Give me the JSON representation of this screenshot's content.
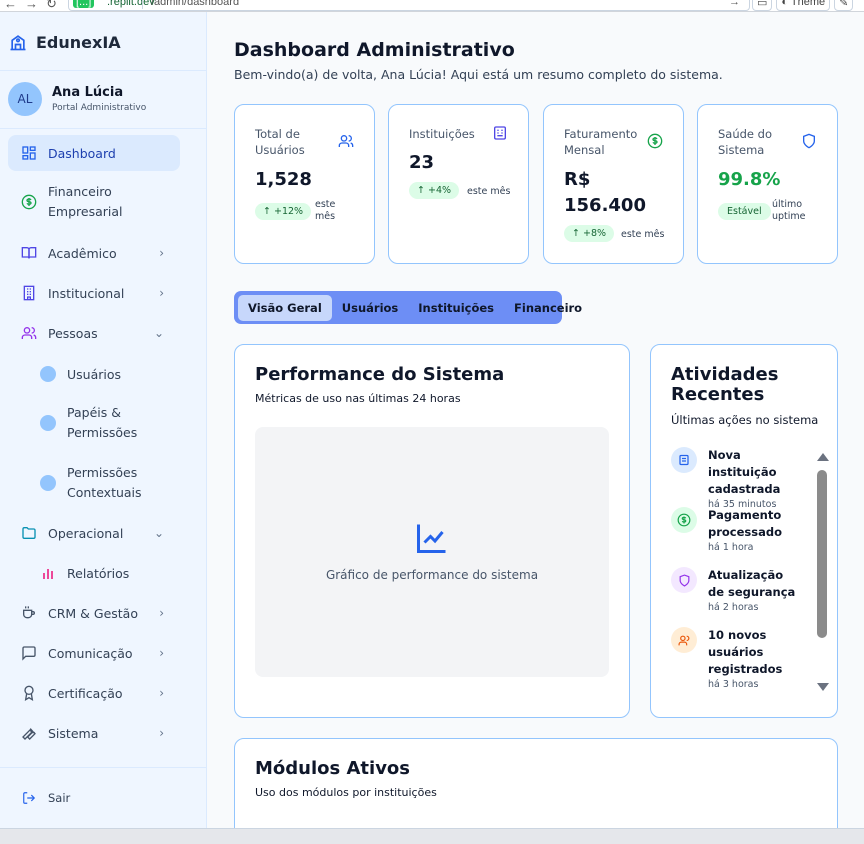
{
  "browser": {
    "host_badge": "[...]",
    "host_rest": ".replit.dev",
    "path": "/admin/dashboard",
    "theme_label": "Theme"
  },
  "app": {
    "name": "EdunexIA"
  },
  "user": {
    "initials": "AL",
    "name": "Ana Lúcia",
    "role": "Portal Administrativo"
  },
  "sidebar": {
    "items": [
      {
        "label": "Dashboard",
        "icon": "grid-icon",
        "active": true
      },
      {
        "label": "Financeiro Empresarial",
        "icon": "dollar-circle-icon"
      },
      {
        "label": "Acadêmico",
        "icon": "book-open-icon",
        "chevron": "right"
      },
      {
        "label": "Institucional",
        "icon": "building-icon",
        "chevron": "right"
      },
      {
        "label": "Pessoas",
        "icon": "users-icon",
        "chevron": "down"
      },
      {
        "label": "Operacional",
        "icon": "folder-icon",
        "chevron": "down"
      },
      {
        "label": "CRM & Gestão",
        "icon": "coffee-icon",
        "chevron": "right"
      },
      {
        "label": "Comunicação",
        "icon": "message-square-icon",
        "chevron": "right"
      },
      {
        "label": "Certificação",
        "icon": "award-icon",
        "chevron": "right"
      },
      {
        "label": "Sistema",
        "icon": "wrench-icon",
        "chevron": "right"
      }
    ],
    "pessoas_sub": [
      {
        "label": "Usuários"
      },
      {
        "label": "Papéis & Permissões"
      },
      {
        "label": "Permissões Contextuais"
      }
    ],
    "operacional_sub": [
      {
        "label": "Relatórios",
        "icon": "bar-chart-icon"
      }
    ],
    "logout_label": "Sair"
  },
  "header": {
    "title": "Dashboard Administrativo",
    "subtitle": "Bem-vindo(a) de volta, Ana Lúcia! Aqui está um resumo completo do sistema."
  },
  "stats": [
    {
      "label": "Total de Usuários",
      "value": "1,528",
      "change": "+12%",
      "note": "este mês",
      "icon": "users-icon",
      "color": "#2563eb"
    },
    {
      "label": "Instituições",
      "value": "23",
      "change": "+4%",
      "note": "este mês",
      "icon": "building-icon",
      "color": "#4f46e5"
    },
    {
      "label": "Faturamento Mensal",
      "value": "R$ 156.400",
      "change": "+8%",
      "note": "este mês",
      "icon": "dollar-circle-icon",
      "color": "#16a34a"
    },
    {
      "label": "Saúde do Sistema",
      "value": "99.8%",
      "change": "Estável",
      "note": "último uptime",
      "icon": "shield-icon",
      "color": "#2563eb",
      "value_color": "#16a34a"
    }
  ],
  "tabs": [
    {
      "label": "Visão Geral",
      "active": true
    },
    {
      "label": "Usuários"
    },
    {
      "label": "Instituições"
    },
    {
      "label": "Financeiro"
    }
  ],
  "performance": {
    "title": "Performance do Sistema",
    "subtitle": "Métricas de uso nas últimas 24 horas",
    "placeholder": "Gráfico de performance do sistema"
  },
  "activities": {
    "title": "Atividades Recentes",
    "subtitle": "Últimas ações no sistema",
    "items": [
      {
        "title": "Nova instituição cadastrada",
        "time": "há 35 minutos",
        "icon": "building-icon",
        "bg": "#dbeafe",
        "fg": "#2563eb"
      },
      {
        "title": "Pagamento processado",
        "time": "há 1 hora",
        "icon": "dollar-circle-icon",
        "bg": "#dcfce7",
        "fg": "#16a34a"
      },
      {
        "title": "Atualização de segurança",
        "time": "há 2 horas",
        "icon": "shield-icon",
        "bg": "#f3e8ff",
        "fg": "#9333ea"
      },
      {
        "title": "10 novos usuários registrados",
        "time": "há 3 horas",
        "icon": "users-icon",
        "bg": "#ffedd5",
        "fg": "#ea580c"
      }
    ]
  },
  "modules": {
    "title": "Módulos Ativos",
    "subtitle": "Uso dos módulos por instituições"
  }
}
